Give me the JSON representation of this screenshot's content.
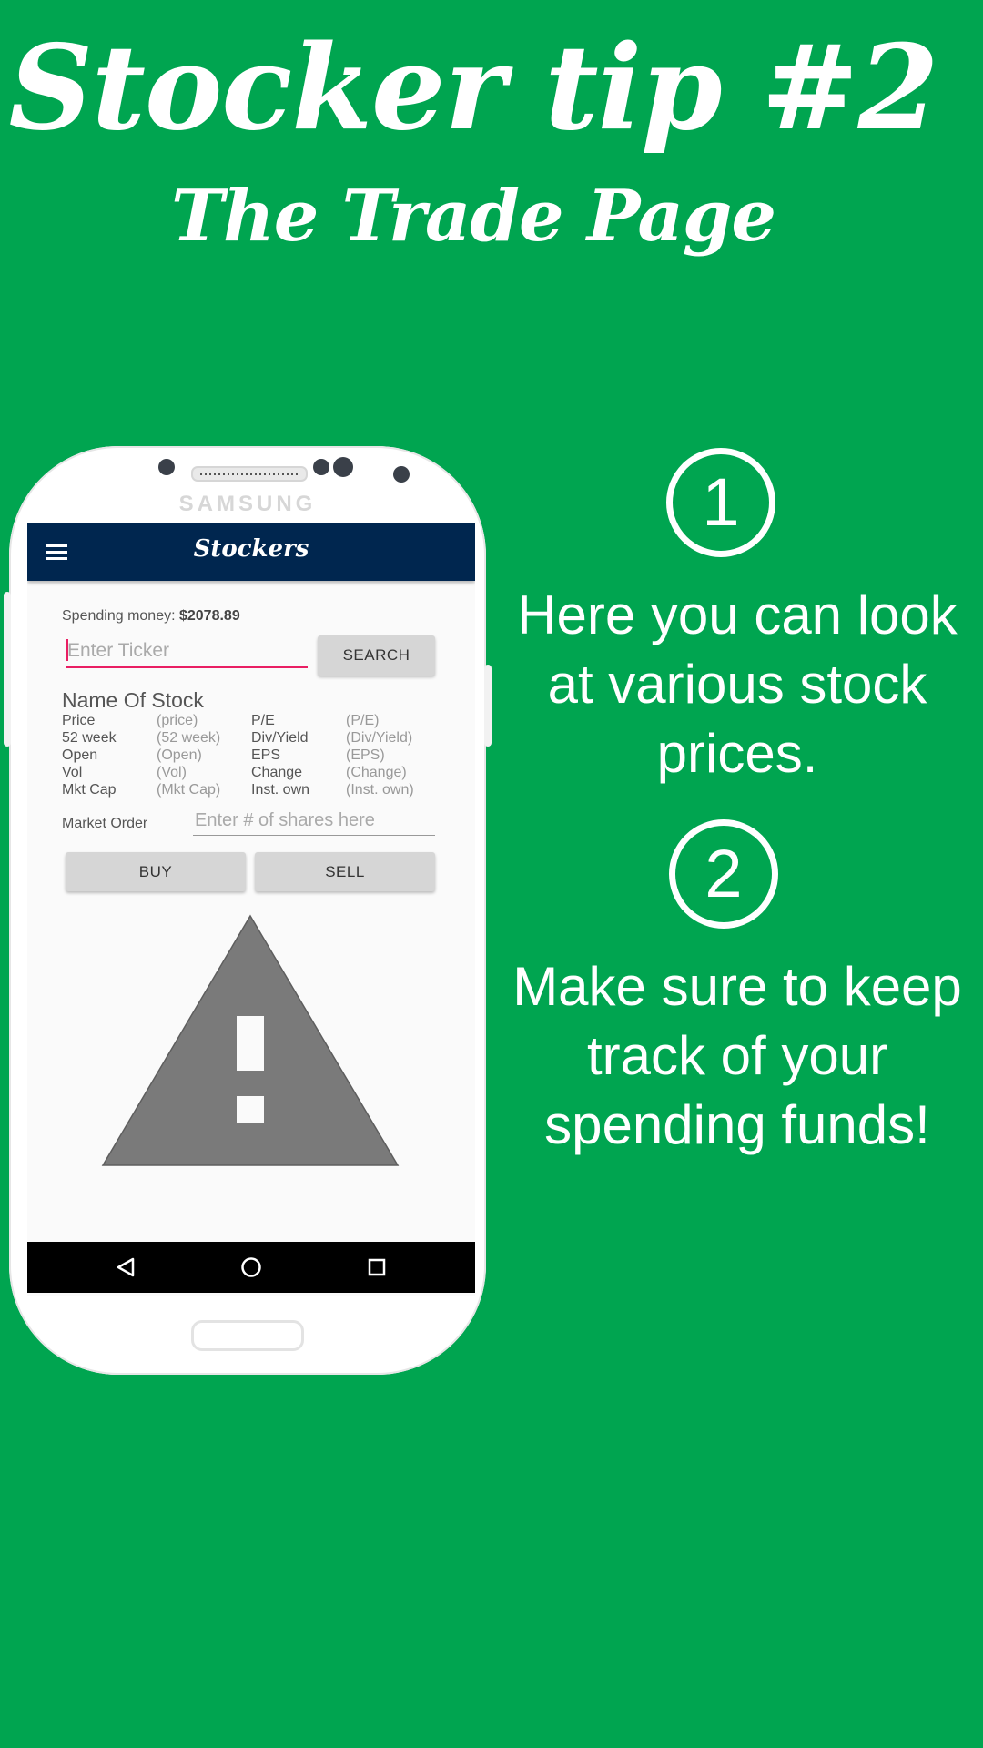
{
  "header": {
    "title": "Stocker tip #2",
    "subtitle": "The Trade Page"
  },
  "phone": {
    "brand": "SAMSUNG"
  },
  "app": {
    "title": "Stockers",
    "spending_label": "Spending money:",
    "spending_value": "$2078.89",
    "ticker_placeholder": "Enter Ticker",
    "search_label": "SEARCH",
    "stock_name": "Name Of Stock",
    "stats_left": [
      {
        "label": "Price",
        "value": "(price)"
      },
      {
        "label": "52 week",
        "value": "(52 week)"
      },
      {
        "label": "Open",
        "value": "(Open)"
      },
      {
        "label": "Vol",
        "value": "(Vol)"
      },
      {
        "label": "Mkt Cap",
        "value": "(Mkt Cap)"
      }
    ],
    "stats_right": [
      {
        "label": "P/E",
        "value": "(P/E)"
      },
      {
        "label": "Div/Yield",
        "value": "(Div/Yield)"
      },
      {
        "label": "EPS",
        "value": "(EPS)"
      },
      {
        "label": "Change",
        "value": "(Change)"
      },
      {
        "label": "Inst. own",
        "value": "(Inst. own)"
      }
    ],
    "market_order_label": "Market Order",
    "shares_placeholder": "Enter # of shares here",
    "buy_label": "BUY",
    "sell_label": "SELL"
  },
  "tips": [
    {
      "number": "1",
      "text": "Here you can look at various stock prices."
    },
    {
      "number": "2",
      "text": "Make sure to keep track of your spending funds!"
    }
  ],
  "colors": {
    "background": "#00a550",
    "appbar": "#00264f",
    "accent": "#e91e63",
    "warning": "#7a7a7a"
  }
}
